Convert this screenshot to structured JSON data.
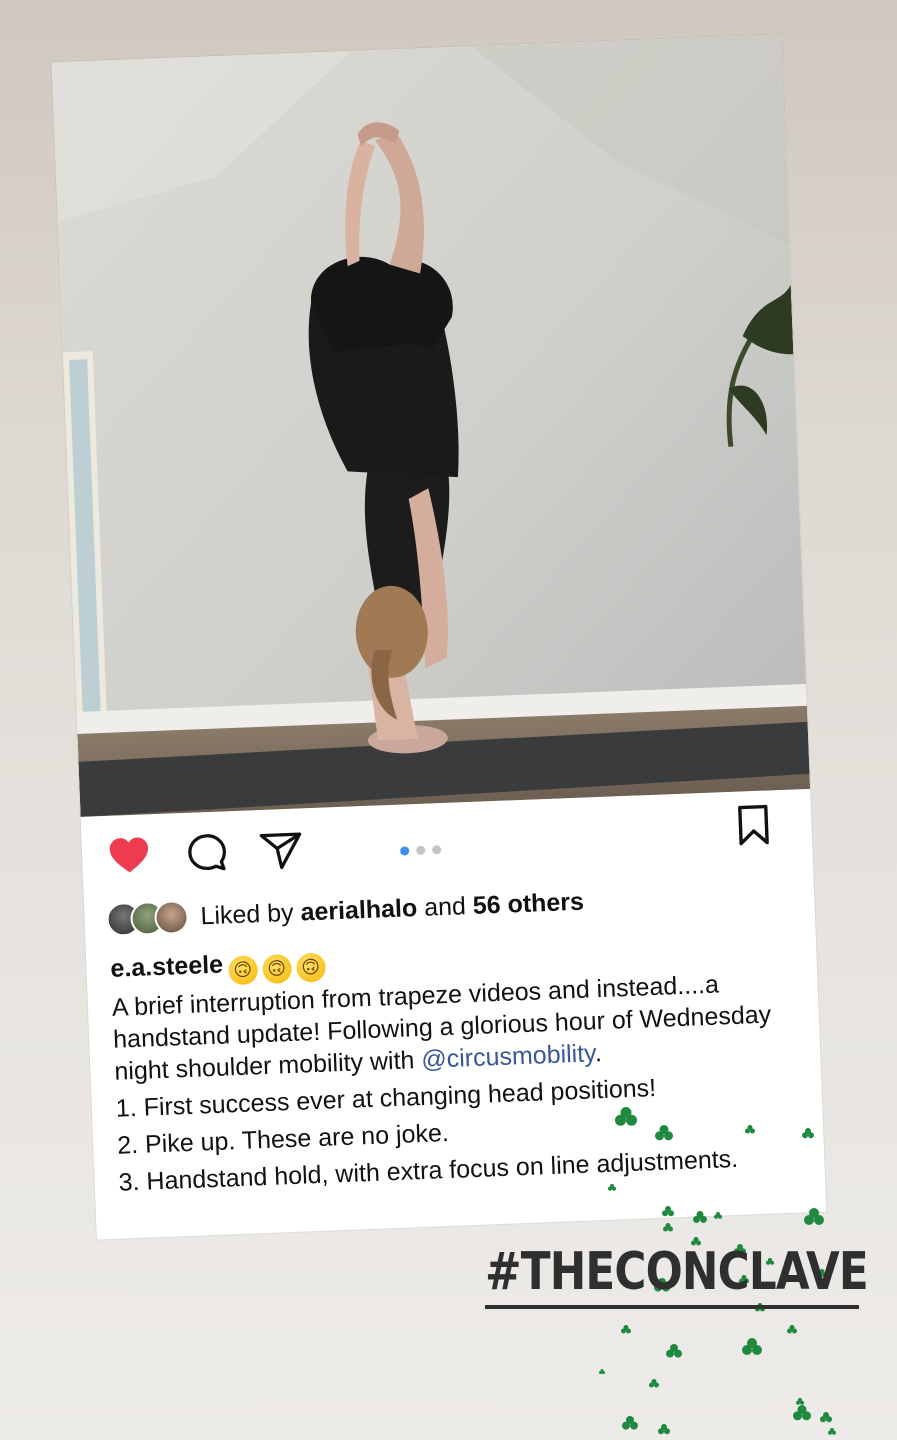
{
  "post": {
    "image": {
      "description": "woman doing a tucked handstand on a yoga mat"
    },
    "actions": {
      "like_icon": "heart-filled-icon",
      "comment_icon": "comment-bubble-icon",
      "share_icon": "paper-plane-icon",
      "save_icon": "bookmark-icon",
      "like_color": "#ee3b4f"
    },
    "carousel": {
      "count": 3,
      "active_index": 0
    },
    "likes": {
      "prefix": "Liked by",
      "liker": "aerialhalo",
      "connector": "and",
      "others": "56 others"
    },
    "caption": {
      "username": "e.a.steele",
      "emojis": [
        "🙃",
        "🙃",
        "🙃"
      ],
      "intro": "A brief interruption from trapeze videos and instead....a handstand update! Following a glorious hour of Wednesday night shoulder mobility with",
      "mention": "@circusmobility",
      "period": ".",
      "points": [
        "1. First success ever at changing head positions!",
        "2. Pike up. These are no joke.",
        "3. Handstand hold, with extra focus on line adjustments."
      ]
    }
  },
  "story": {
    "hashtag": "#THECONCLAVE",
    "sticker_color": "#1f8a3f",
    "background_color": "#e5e1dc"
  }
}
